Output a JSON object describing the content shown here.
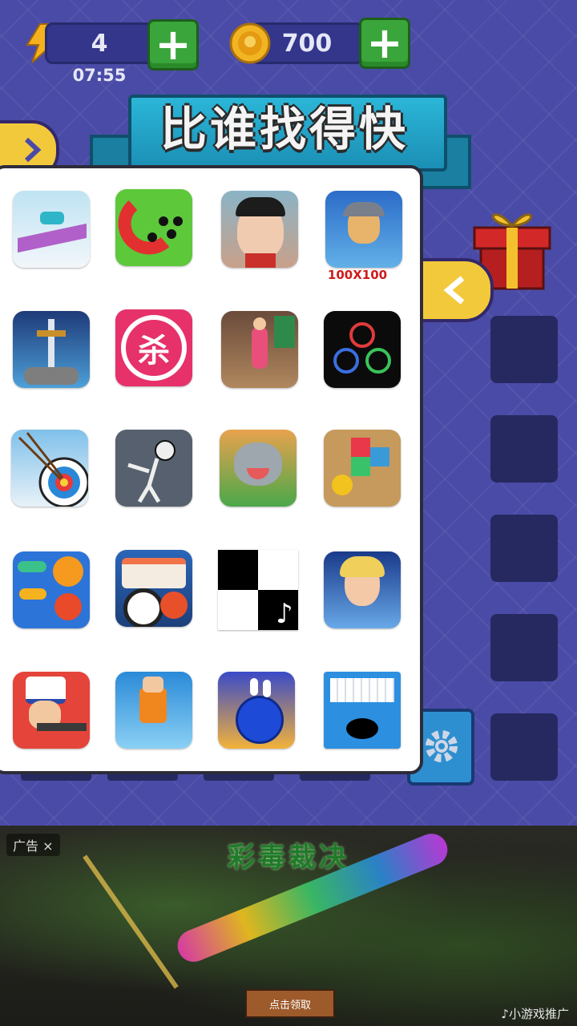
{
  "hud": {
    "energy": {
      "count": "4",
      "timer": "07:55"
    },
    "coins": {
      "count": "700"
    },
    "plus_symbol": "+"
  },
  "title": "比谁找得快",
  "panel": {
    "size_label": "100X100",
    "games": [
      {
        "icon": "racing-car-game-icon"
      },
      {
        "icon": "magnet-balls-game-icon"
      },
      {
        "icon": "cartoon-boy-game-icon"
      },
      {
        "icon": "viking-warrior-game-icon"
      },
      {
        "icon": "sword-in-stone-game-icon"
      },
      {
        "icon": "kill-target-game-icon",
        "text": "杀"
      },
      {
        "icon": "subway-runner-game-icon"
      },
      {
        "icon": "finger-circles-game-icon"
      },
      {
        "icon": "archery-target-game-icon"
      },
      {
        "icon": "stickman-game-icon"
      },
      {
        "icon": "talking-cat-game-icon"
      },
      {
        "icon": "color-blocks-ball-game-icon"
      },
      {
        "icon": "color-rings-game-icon"
      },
      {
        "icon": "sushi-game-icon"
      },
      {
        "icon": "piano-tiles-game-icon",
        "text": "♪"
      },
      {
        "icon": "fantasy-hero-game-icon"
      },
      {
        "icon": "sniper-game-icon"
      },
      {
        "icon": "parkour-runner-game-icon"
      },
      {
        "icon": "bowling-game-icon"
      },
      {
        "icon": "hole-game-icon"
      }
    ]
  },
  "ad": {
    "tag": "广告 ×",
    "title": "彩毒裁决",
    "cta": "点击领取",
    "footer": "小游戏推广"
  },
  "colors": {
    "background": "#4a4ba6",
    "ribbon": "#2bb6d8",
    "plus_button": "#3aa53a",
    "side_button": "#f3c93c"
  }
}
